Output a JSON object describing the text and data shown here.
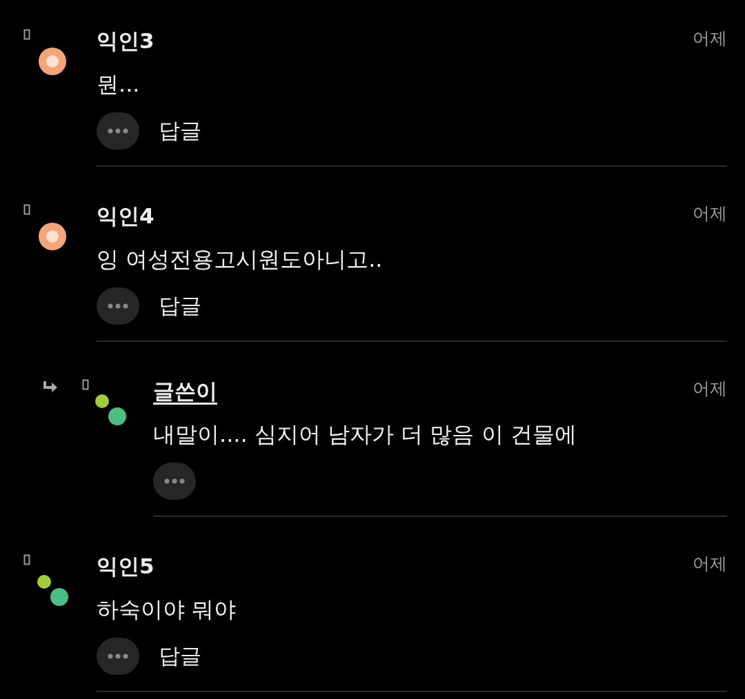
{
  "comments": [
    {
      "name": "익인3",
      "author": false,
      "avatar": {
        "kind": "ring"
      },
      "time": "어제",
      "text": "뭔...",
      "reply_label": "답글"
    },
    {
      "name": "익인4",
      "author": false,
      "avatar": {
        "kind": "ring"
      },
      "time": "어제",
      "text": "잉 여성전용고시원도아니고..",
      "reply_label": "답글",
      "children": [
        {
          "name": "글쓴이",
          "author": true,
          "avatar": {
            "kind": "dots"
          },
          "time": "어제",
          "text": "내말이.... 심지어 남자가 더 많음 이 건물에"
        }
      ]
    },
    {
      "name": "익인5",
      "author": false,
      "avatar": {
        "kind": "dots"
      },
      "time": "어제",
      "text": "하숙이야 뭐야",
      "reply_label": "답글"
    }
  ]
}
